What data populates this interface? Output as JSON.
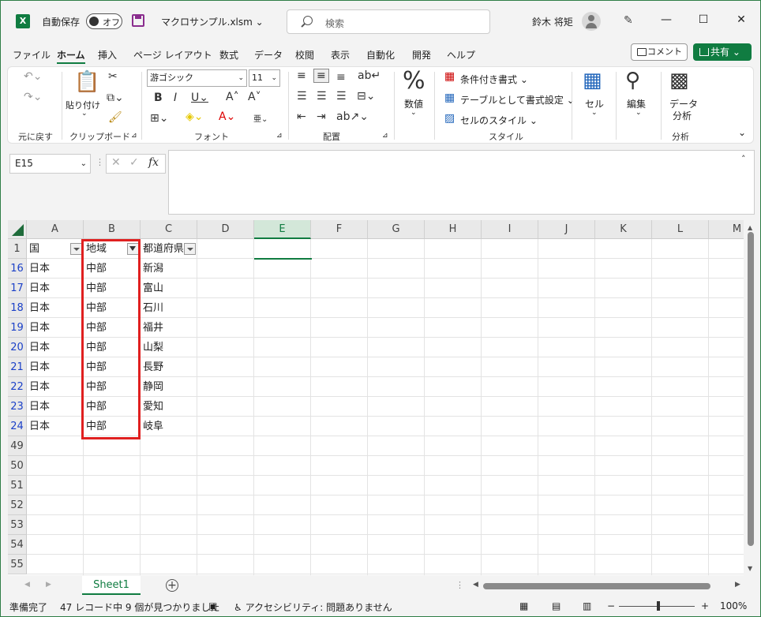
{
  "titlebar": {
    "app_icon": "excel-logo",
    "autosave_label": "自動保存",
    "autosave_state": "オフ",
    "filename": "マクロサンプル.xlsm",
    "search_placeholder": "検索",
    "username": "鈴木 将矩"
  },
  "menu": {
    "items": [
      "ファイル",
      "ホーム",
      "挿入",
      "ページ レイアウト",
      "数式",
      "データ",
      "校閲",
      "表示",
      "自動化",
      "開発",
      "ヘルプ"
    ],
    "active": "ホーム",
    "comment_label": "コメント",
    "share_label": "共有"
  },
  "ribbon": {
    "undo_group": "元に戻す",
    "clipboard_group": "クリップボード",
    "paste_label": "貼り付け",
    "font_group": "フォント",
    "font_name": "游ゴシック",
    "font_size": "11",
    "alignment_group": "配置",
    "number_label": "数値",
    "conditional_format": "条件付き書式",
    "format_as_table": "テーブルとして書式設定",
    "cell_styles": "セルのスタイル",
    "styles_group": "スタイル",
    "cells_label": "セル",
    "editing_label": "編集",
    "data_analysis_line1": "データ",
    "data_analysis_line2": "分析",
    "analysis_group": "分析"
  },
  "formula_bar": {
    "name_box": "E15",
    "fx": "fx",
    "formula": ""
  },
  "grid": {
    "columns": [
      "A",
      "B",
      "C",
      "D",
      "E",
      "F",
      "G",
      "H",
      "I",
      "J",
      "K",
      "L",
      "M"
    ],
    "selected_column": "E",
    "header_row": {
      "row": "1",
      "cells": [
        "国",
        "地域",
        "都道府県"
      ]
    },
    "rows": [
      {
        "row": "16",
        "cells": [
          "日本",
          "中部",
          "新潟"
        ]
      },
      {
        "row": "17",
        "cells": [
          "日本",
          "中部",
          "富山"
        ]
      },
      {
        "row": "18",
        "cells": [
          "日本",
          "中部",
          "石川"
        ]
      },
      {
        "row": "19",
        "cells": [
          "日本",
          "中部",
          "福井"
        ]
      },
      {
        "row": "20",
        "cells": [
          "日本",
          "中部",
          "山梨"
        ]
      },
      {
        "row": "21",
        "cells": [
          "日本",
          "中部",
          "長野"
        ]
      },
      {
        "row": "22",
        "cells": [
          "日本",
          "中部",
          "静岡"
        ]
      },
      {
        "row": "23",
        "cells": [
          "日本",
          "中部",
          "愛知"
        ]
      },
      {
        "row": "24",
        "cells": [
          "日本",
          "中部",
          "岐阜"
        ]
      },
      {
        "row": "49",
        "cells": []
      },
      {
        "row": "50",
        "cells": []
      },
      {
        "row": "51",
        "cells": []
      },
      {
        "row": "52",
        "cells": []
      },
      {
        "row": "53",
        "cells": []
      },
      {
        "row": "54",
        "cells": []
      },
      {
        "row": "55",
        "cells": []
      }
    ]
  },
  "sheets": {
    "tabs": [
      "Sheet1"
    ]
  },
  "status": {
    "ready": "準備完了",
    "filter_result": "47 レコード中 9 個が見つかりました",
    "accessibility": "アクセシビリティ: 問題ありません",
    "zoom": "100%"
  },
  "colors": {
    "accent": "#107c41",
    "highlight_box": "#e02020",
    "filtered_row_number": "#1c41c8"
  }
}
